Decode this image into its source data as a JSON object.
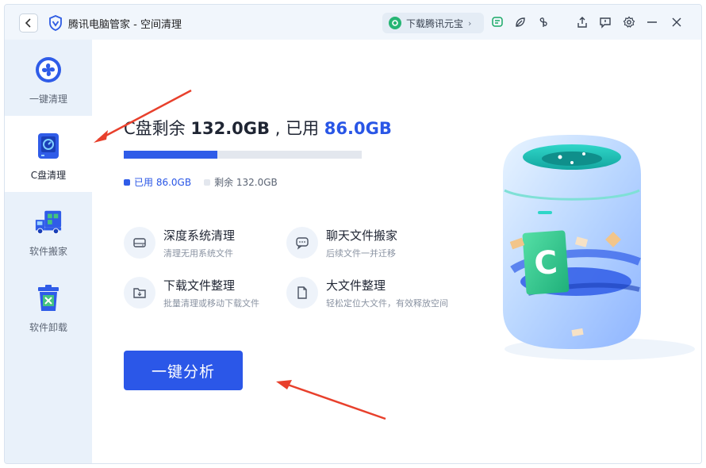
{
  "window": {
    "title": "腾讯电脑管家 - 空间清理"
  },
  "titlebar": {
    "download_label": "下载腾讯元宝",
    "icons": [
      "back-icon",
      "shield-logo-icon",
      "yuanbao-icon",
      "chat-list-icon",
      "leaf-icon",
      "fan-icon",
      "share-icon",
      "feedback-icon",
      "settings-icon",
      "minimize-icon",
      "close-icon"
    ]
  },
  "sidebar": {
    "items": [
      {
        "label": "一键清理",
        "icon": "fan-clean-icon",
        "active": false
      },
      {
        "label": "C盘清理",
        "icon": "disk-c-icon",
        "active": true
      },
      {
        "label": "软件搬家",
        "icon": "truck-move-icon",
        "active": false
      },
      {
        "label": "软件卸载",
        "icon": "trash-uninstall-icon",
        "active": false
      }
    ]
  },
  "disk": {
    "prefix": "C盘剩余",
    "free": "132.0GB",
    "separator": ", 已用",
    "used": "86.0GB",
    "used_fraction": 0.394,
    "legend_used": "已用 86.0GB",
    "legend_free": "剩余 132.0GB",
    "color_used": "#2f5ce8",
    "color_free": "#e3e7ee"
  },
  "features": [
    {
      "title": "深度系统清理",
      "desc": "清理无用系统文件",
      "icon": "hard-drive-icon"
    },
    {
      "title": "聊天文件搬家",
      "desc": "后续文件一并迁移",
      "icon": "chat-icon"
    },
    {
      "title": "下载文件整理",
      "desc": "批量清理或移动下载文件",
      "icon": "download-folder-icon"
    },
    {
      "title": "大文件整理",
      "desc": "轻松定位大文件，有效释放空间",
      "icon": "document-icon"
    }
  ],
  "action": {
    "analyze_label": "一键分析"
  },
  "accent": "#2b57e8"
}
